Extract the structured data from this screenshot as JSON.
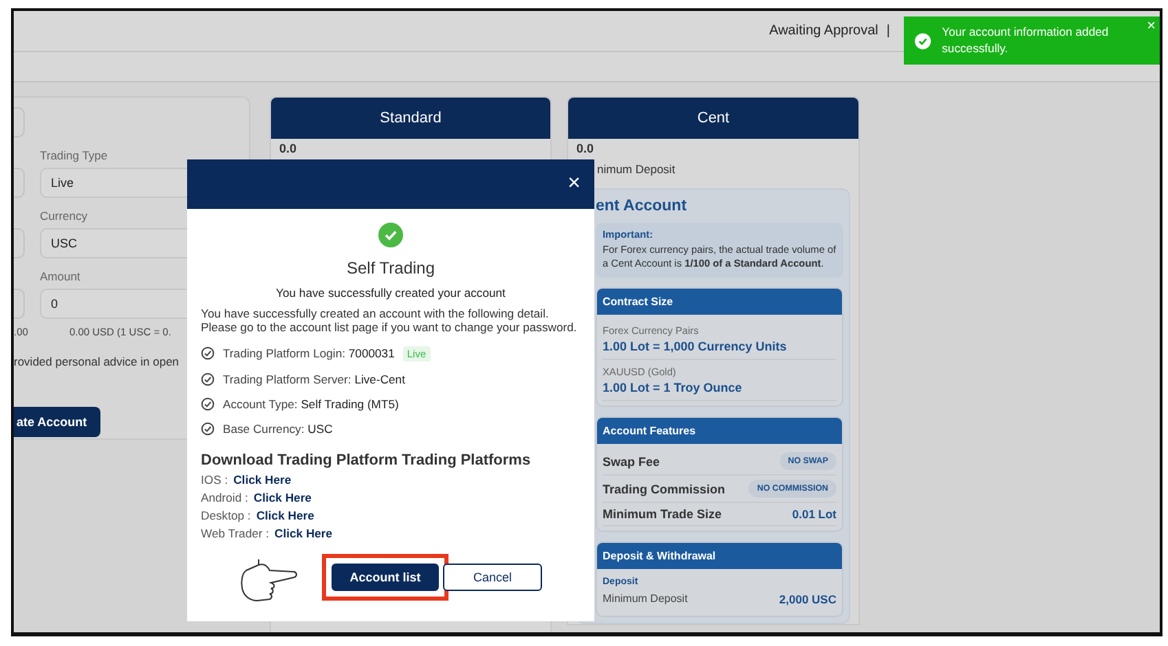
{
  "header": {
    "status": "Awaiting Approval",
    "separator": "|"
  },
  "form": {
    "fields": [
      {
        "label": "Trading Type",
        "value": "Live"
      },
      {
        "label": "Currency",
        "value": "USC"
      },
      {
        "label": "Amount",
        "value": "0"
      }
    ],
    "balance": ".00",
    "conversion": "0.00 USD (1 USC = 0.",
    "disclaimer": "rovided personal advice in open",
    "submit": "ate Account"
  },
  "standard_card": {
    "title": "Standard",
    "value": "0.0"
  },
  "cent_card": {
    "title": "Cent",
    "value": "0.0",
    "value_label": "nimum Deposit",
    "panel_title": "ent Account",
    "notice": {
      "title": "Important:",
      "text": "For Forex currency pairs, the actual trade volume of a Cent Account is **1/100 of a Standard Account**."
    },
    "sections": [
      {
        "kind": "stacked",
        "title": "Contract Size",
        "rows": [
          {
            "label": "Forex Currency Pairs",
            "value": "1.00 Lot = 1,000 Currency Units"
          },
          {
            "label": "XAUUSD (Gold)",
            "value": "1.00 Lot = 1 Troy Ounce"
          }
        ]
      },
      {
        "kind": "features",
        "title": "Account Features",
        "rows": [
          {
            "label": "Swap Fee",
            "value": "NO SWAP",
            "kind": "badge"
          },
          {
            "label": "Trading Commission",
            "value": "NO COMMISSION",
            "kind": "badge"
          },
          {
            "label": "Minimum Trade Size",
            "value": "0.01 Lot",
            "kind": "text"
          }
        ]
      },
      {
        "kind": "deposit",
        "title": "Deposit & Withdrawal",
        "subtitle": "Deposit",
        "rows": [
          {
            "label": "Minimum Deposit",
            "value": "2,000 USC",
            "kind": "text"
          }
        ]
      }
    ]
  },
  "modal": {
    "close": "×",
    "heading": "Self Trading",
    "subheading": "You have successfully created your account",
    "message": "You have successfully created an account with the following detail. Please go to the account list page if you want to change your password.",
    "details": [
      {
        "label": "Trading Platform Login:",
        "value": "7000031",
        "badge": "Live"
      },
      {
        "label": "Trading Platform Server:",
        "value": "Live-Cent"
      },
      {
        "label": "Account Type:",
        "value": "Self Trading (MT5)"
      },
      {
        "label": "Base Currency:",
        "value": "USC"
      }
    ],
    "downloads_title": "Download Trading Platform Trading Platforms",
    "downloads": [
      {
        "platform": "IOS :",
        "link": "Click Here"
      },
      {
        "platform": "Android :",
        "link": "Click Here"
      },
      {
        "platform": "Desktop :",
        "link": "Click Here"
      },
      {
        "platform": "Web Trader :",
        "link": "Click Here"
      }
    ],
    "buttons": [
      {
        "label": "Account list",
        "kind": "primary",
        "highlighted": true
      },
      {
        "label": "Cancel",
        "kind": "secondary",
        "highlighted": false
      }
    ]
  },
  "toast": {
    "message": "Your account information added successfully.",
    "close": "×"
  }
}
